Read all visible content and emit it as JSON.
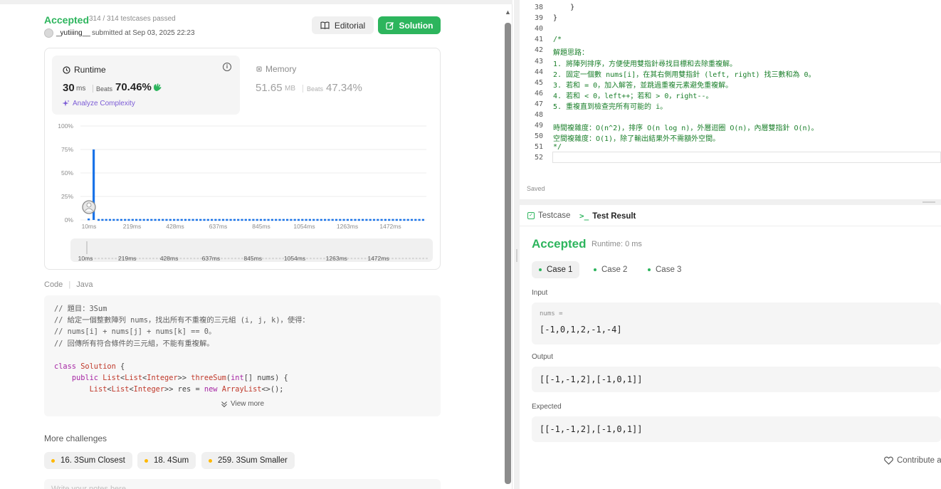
{
  "submission": {
    "status": "Accepted",
    "testcases": "314 / 314 testcases passed",
    "user": "_yutiiing__",
    "submitted": "submitted at Sep 03, 2025 22:23",
    "editorial_label": "Editorial",
    "solution_label": "Solution"
  },
  "runtime": {
    "title": "Runtime",
    "value": "30",
    "unit": "ms",
    "beats_label": "Beats",
    "beats": "70.46%",
    "analyze": "Analyze Complexity"
  },
  "memory": {
    "title": "Memory",
    "value": "51.65",
    "unit": "MB",
    "beats_label": "Beats",
    "beats": "47.34%"
  },
  "chart_data": {
    "type": "bar",
    "y_ticks": [
      "100%",
      "75%",
      "50%",
      "25%",
      "0%"
    ],
    "ylim": [
      0,
      100
    ],
    "x_ticks": [
      "10ms",
      "219ms",
      "428ms",
      "637ms",
      "845ms",
      "1054ms",
      "1263ms",
      "1472ms"
    ],
    "bars": [
      {
        "x": "10ms",
        "value": 1.5
      },
      {
        "x": "~25ms",
        "value": 75
      },
      {
        "x": "rest",
        "value": 1
      }
    ],
    "your_position": "30ms",
    "color": "#1a73e8"
  },
  "code": {
    "label": "Code",
    "language": "Java",
    "lines": [
      "// 題目：3Sum",
      "// 給定一個整數陣列 nums，找出所有不重複的三元組 (i, j, k)，使得：",
      "// nums[i] + nums[j] + nums[k] == 0。",
      "// 回傳所有符合條件的三元組，不能有重複解。",
      "",
      "class Solution {",
      "    public List<List<Integer>> threeSum(int[] nums) {",
      "        List<List<Integer>> res = new ArrayList<>();"
    ],
    "view_more": "View more"
  },
  "more_challenges": {
    "title": "More challenges",
    "items": [
      "16. 3Sum Closest",
      "18. 4Sum",
      "259. 3Sum Smaller"
    ]
  },
  "notes_placeholder": "Write your notes here",
  "editor": {
    "lines": [
      {
        "n": "38",
        "t": "    }",
        "plain": true
      },
      {
        "n": "39",
        "t": "}",
        "plain": true
      },
      {
        "n": "40",
        "t": "",
        "plain": true
      },
      {
        "n": "41",
        "t": "/*",
        "plain": false
      },
      {
        "n": "42",
        "t": "解題思路：",
        "plain": false
      },
      {
        "n": "43",
        "t": "1. 將陣列排序，方便使用雙指針尋找目標和去除重複解。",
        "plain": false
      },
      {
        "n": "44",
        "t": "2. 固定一個數 nums[i]，在其右側用雙指針 (left, right) 找三數和為 0。",
        "plain": false
      },
      {
        "n": "45",
        "t": "3. 若和 = 0，加入解答，並跳過重複元素避免重複解。",
        "plain": false
      },
      {
        "n": "46",
        "t": "4. 若和 < 0，left++；若和 > 0，right--。",
        "plain": false
      },
      {
        "n": "47",
        "t": "5. 重複直到檢查完所有可能的 i。",
        "plain": false
      },
      {
        "n": "48",
        "t": "",
        "plain": false
      },
      {
        "n": "49",
        "t": "時間複雜度：O(n^2)，排序 O(n log n)，外層迴圈 O(n)，內層雙指針 O(n)。",
        "plain": false
      },
      {
        "n": "50",
        "t": "空間複雜度：O(1)，除了輸出結果外不需額外空間。",
        "plain": false
      },
      {
        "n": "51",
        "t": "*/",
        "plain": false
      },
      {
        "n": "52",
        "t": "",
        "plain": true
      }
    ],
    "saved": "Saved"
  },
  "testpanel": {
    "tab_testcase": "Testcase",
    "tab_result": "Test Result",
    "status": "Accepted",
    "runtime": "Runtime: 0 ms",
    "cases": [
      "Case 1",
      "Case 2",
      "Case 3"
    ],
    "input_label": "Input",
    "input_name": "nums =",
    "input_value": "[-1,0,1,2,-1,-4]",
    "output_label": "Output",
    "output_value": "[[-1,-1,2],[-1,0,1]]",
    "expected_label": "Expected",
    "expected_value": "[[-1,-1,2],[-1,0,1]]",
    "contribute": "Contribute a"
  }
}
